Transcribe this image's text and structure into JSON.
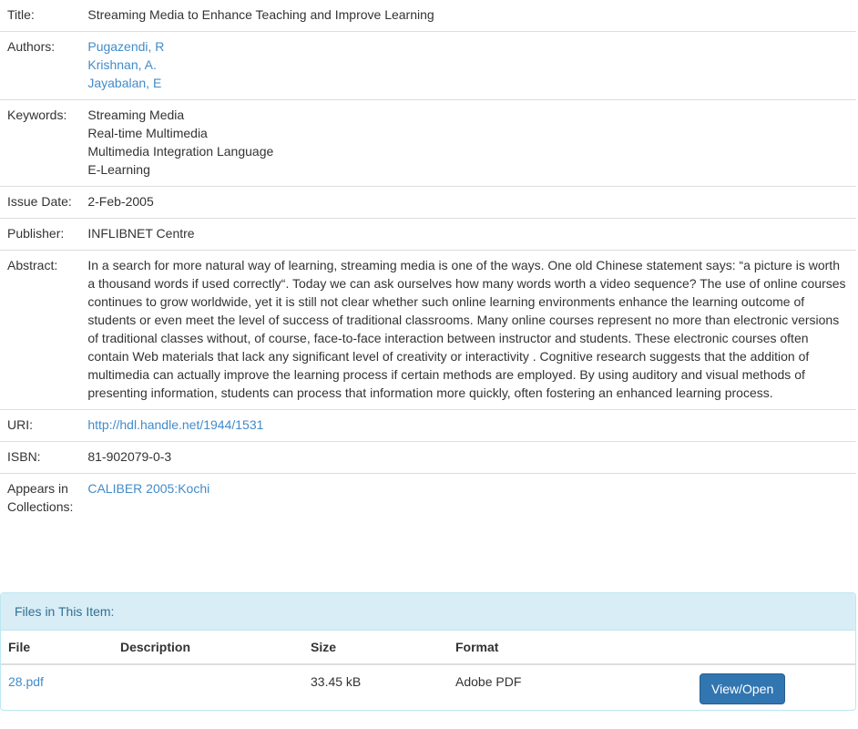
{
  "metadata": {
    "title_label": "Title:",
    "title": "Streaming Media to Enhance Teaching and Improve Learning",
    "authors_label": "Authors:",
    "authors": [
      "Pugazendi, R",
      "Krishnan, A.",
      "Jayabalan, E"
    ],
    "keywords_label": "Keywords:",
    "keywords": [
      "Streaming Media",
      "Real-time Multimedia",
      "Multimedia Integration Language",
      "E-Learning"
    ],
    "issue_date_label": "Issue Date:",
    "issue_date": "2-Feb-2005",
    "publisher_label": "Publisher:",
    "publisher": "INFLIBNET Centre",
    "abstract_label": "Abstract:",
    "abstract": "In a search for more natural way of learning, streaming media is one of the ways. One old Chinese statement says: “a picture is worth a thousand words if used correctly“. Today we can ask ourselves how many words worth a video sequence? The use of online courses continues to grow worldwide, yet it is still not clear whether such online learning environments enhance the learning outcome of students or even meet the level of success of traditional classrooms. Many online courses represent no more than electronic versions of traditional classes without, of course, face-to-face interaction between instructor and students. These electronic courses often contain Web materials that lack any significant level of creativity or interactivity . Cognitive research suggests that the addition of multimedia can actually improve the learning process if certain methods are employed. By using auditory and visual methods of presenting information, students can process that information more quickly, often fostering an enhanced learning process.",
    "uri_label": "URI:",
    "uri": "http://hdl.handle.net/1944/1531",
    "isbn_label": "ISBN:",
    "isbn": "81-902079-0-3",
    "collections_label": "Appears in Collections:",
    "collection": "CALIBER 2005:Kochi"
  },
  "files": {
    "heading": "Files in This Item:",
    "columns": {
      "file": "File",
      "description": "Description",
      "size": "Size",
      "format": "Format"
    },
    "rows": [
      {
        "file": "28.pdf",
        "description": "",
        "size": "33.45 kB",
        "format": "Adobe PDF",
        "action": "View/Open"
      }
    ]
  },
  "colors": {
    "link": "#428bca",
    "panel_heading_bg": "#d9edf7",
    "panel_heading_text": "#31708f",
    "button_bg": "#3276b1"
  }
}
